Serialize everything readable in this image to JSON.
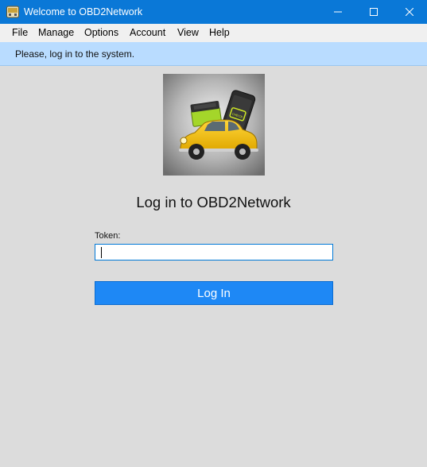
{
  "window": {
    "title": "Welcome to OBD2Network",
    "accent": "#0a78d7"
  },
  "menu": {
    "items": [
      {
        "label": "File"
      },
      {
        "label": "Manage"
      },
      {
        "label": "Options"
      },
      {
        "label": "Account"
      },
      {
        "label": "View"
      },
      {
        "label": "Help"
      }
    ]
  },
  "info": {
    "message": "Please, log in to the system.",
    "color": "#b9dcff"
  },
  "logo": {
    "icon": "obd2-car-device-logo",
    "device_badge_text": "CHECK"
  },
  "login": {
    "heading": "Log in to OBD2Network",
    "token_label": "Token:",
    "token_value": "",
    "button_label": "Log In",
    "button_color": "#1e88f5"
  }
}
